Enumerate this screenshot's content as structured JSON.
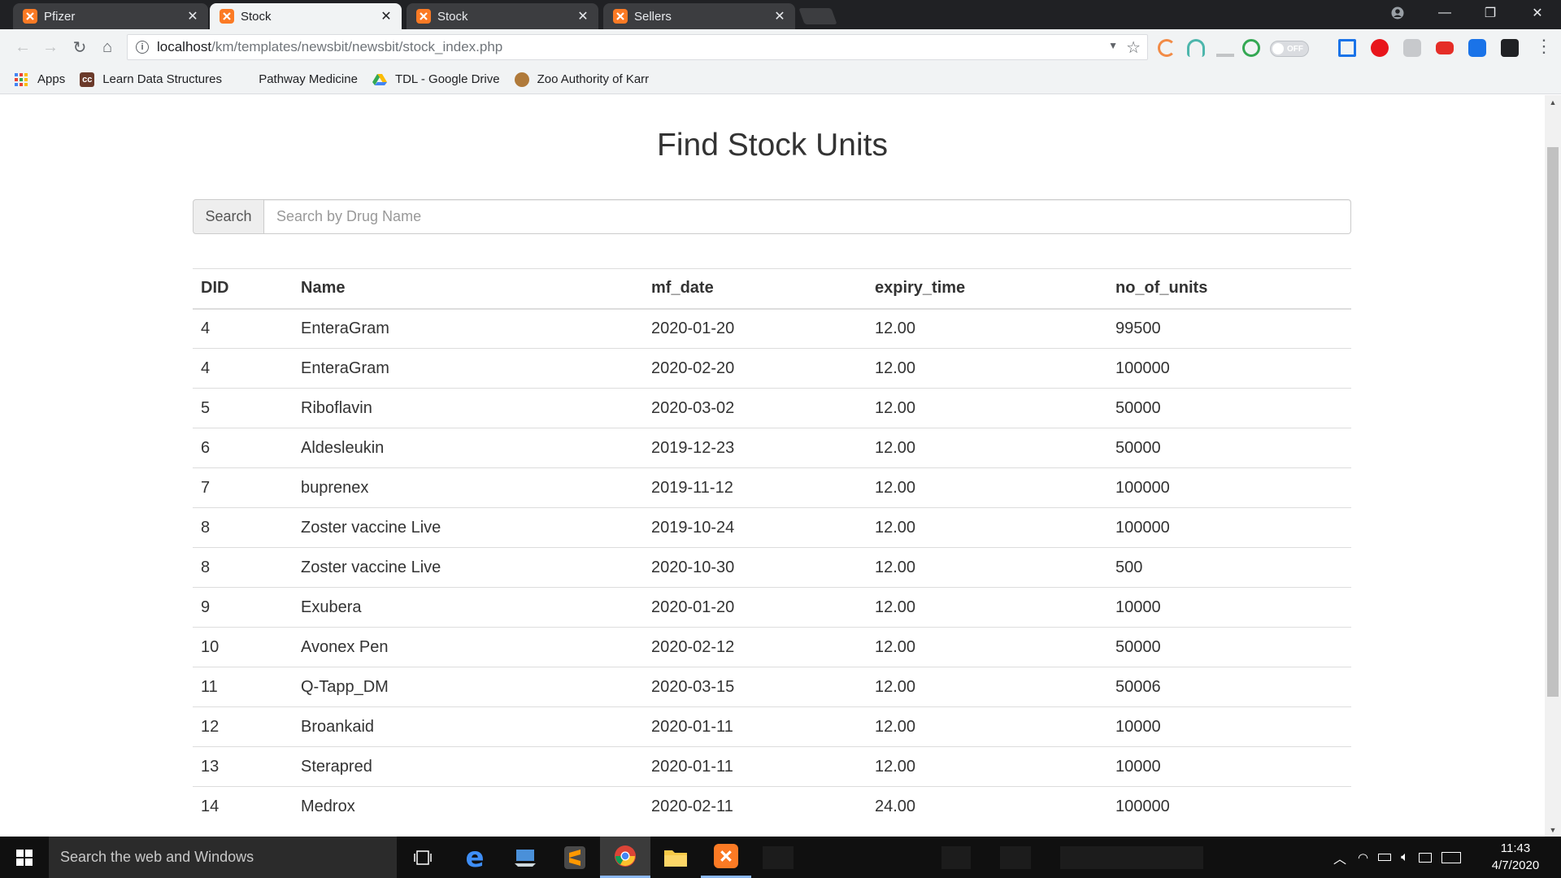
{
  "browser": {
    "tabs": [
      {
        "title": "Pfizer",
        "active": false
      },
      {
        "title": "Stock",
        "active": true
      },
      {
        "title": "Stock",
        "active": false
      },
      {
        "title": "Sellers",
        "active": false
      }
    ],
    "url": {
      "host": "localhost",
      "path": "/km/templates/newsbit/newsbit/stock_index.php"
    },
    "extension_toggle_label": "OFF",
    "bookmarks": [
      {
        "label": "Apps",
        "icon": "apps-grid-icon"
      },
      {
        "label": "Learn Data Structures",
        "icon": "cc-icon"
      },
      {
        "label": "Pathway Medicine",
        "icon": "document-icon"
      },
      {
        "label": "TDL - Google Drive",
        "icon": "google-drive-icon"
      },
      {
        "label": "Zoo Authority of Karr",
        "icon": "zoo-emblem-icon"
      }
    ],
    "colors": {
      "xampp_orange": "#fb7a24",
      "tab_strip": "#202124",
      "toolbar": "#f1f3f4"
    }
  },
  "page": {
    "title": "Find Stock Units",
    "search": {
      "button_label": "Search",
      "placeholder": "Search by Drug Name",
      "value": ""
    },
    "table": {
      "headers": [
        "DID",
        "Name",
        "mf_date",
        "expiry_time",
        "no_of_units"
      ],
      "rows": [
        [
          "4",
          "EnteraGram",
          "2020-01-20",
          "12.00",
          "99500"
        ],
        [
          "4",
          "EnteraGram",
          "2020-02-20",
          "12.00",
          "100000"
        ],
        [
          "5",
          "Riboflavin",
          "2020-03-02",
          "12.00",
          "50000"
        ],
        [
          "6",
          "Aldesleukin",
          "2019-12-23",
          "12.00",
          "50000"
        ],
        [
          "7",
          "buprenex",
          "2019-11-12",
          "12.00",
          "100000"
        ],
        [
          "8",
          "Zoster vaccine Live",
          "2019-10-24",
          "12.00",
          "100000"
        ],
        [
          "8",
          "Zoster vaccine Live",
          "2020-10-30",
          "12.00",
          "500"
        ],
        [
          "9",
          "Exubera",
          "2020-01-20",
          "12.00",
          "10000"
        ],
        [
          "10",
          "Avonex Pen",
          "2020-02-12",
          "12.00",
          "50000"
        ],
        [
          "11",
          "Q-Tapp_DM",
          "2020-03-15",
          "12.00",
          "50006"
        ],
        [
          "12",
          "Broankaid",
          "2020-01-11",
          "12.00",
          "10000"
        ],
        [
          "13",
          "Sterapred",
          "2020-01-11",
          "12.00",
          "10000"
        ],
        [
          "14",
          "Medrox",
          "2020-02-11",
          "24.00",
          "100000"
        ]
      ]
    }
  },
  "taskbar": {
    "search_placeholder": "Search the web and Windows",
    "time": "11:43",
    "date": "4/7/2020",
    "pinned": [
      "task-view-icon",
      "edge-icon",
      "network-app-icon",
      "sublime-text-icon",
      "chrome-icon",
      "file-explorer-icon",
      "xampp-icon"
    ]
  }
}
